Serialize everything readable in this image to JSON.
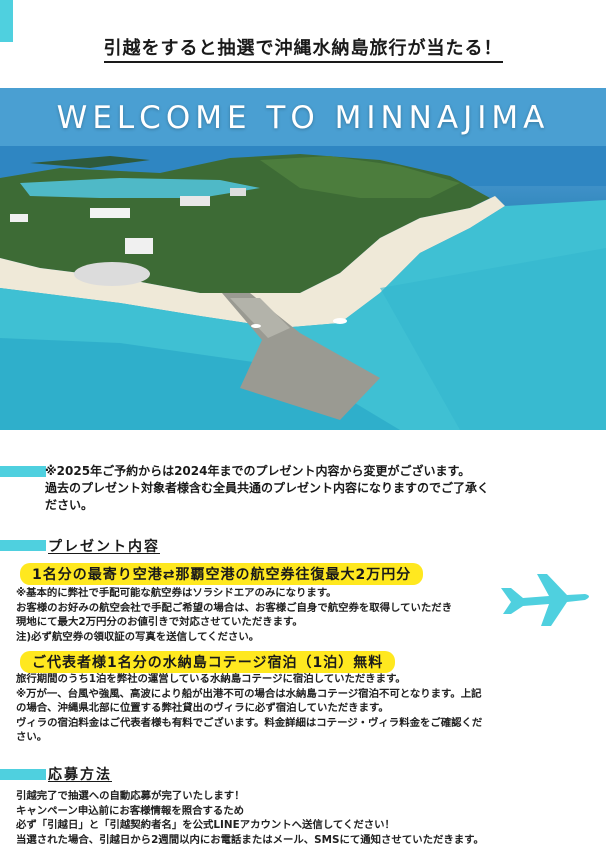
{
  "header": {
    "title": "引越をすると抽選で沖縄水納島旅行が当たる！"
  },
  "hero": {
    "title": "WELCOME TO MINNAJIMA"
  },
  "notice": {
    "lines": [
      "※2025年ご予約からは2024年までのプレゼント内容から変更がございます。",
      "過去のプレゼント対象者様含む全員共通のプレゼント内容になりますのでご了承く",
      "ださい。"
    ]
  },
  "present": {
    "heading": "プレゼント内容",
    "item1": {
      "title": "1名分の最寄り空港⇄那覇空港の航空券往復最大2万円分",
      "lines": [
        "※基本的に弊社で手配可能な航空券はソラシドエアのみになります。",
        "お客様のお好みの航空会社で手配ご希望の場合は、お客様ご自身で航空券を取得していただき",
        "現地にて最大2万円分のお値引きで対応させていただきます。",
        "注)必ず航空券の領収証の写真を送信してください。"
      ]
    },
    "item2": {
      "title": "ご代表者様1名分の水納島コテージ宿泊（1泊）無料",
      "lines": [
        "旅行期間のうち1泊を弊社の運営している水納島コテージに宿泊していただきます。",
        "※万が一、台風や強風、高波により船が出港不可の場合は水納島コテージ宿泊不可となります。上記",
        "の場合、沖縄県北部に位置する弊社貸出のヴィラに必ず宿泊していただきます。",
        "ヴィラの宿泊料金はご代表者様も有料でございます。料金詳細はコテージ・ヴィラ料金をご確認くだ",
        "さい。"
      ]
    }
  },
  "apply": {
    "heading": "応募方法",
    "lines": [
      "引越完了で抽選への自動応募が完了いたします！",
      "キャンペーン申込前にお客様情報を照合するため",
      "必ず「引越日」と「引越契約者名」を公式LINEアカウントへ送信してください！",
      "当選された場合、引越日から2週間以内にお電話またはメール、SMSにて通知させていただきます。"
    ]
  },
  "colors": {
    "accent": "#4fd0df",
    "highlight": "#ffe81f"
  },
  "icons": [
    "airplane-icon"
  ]
}
